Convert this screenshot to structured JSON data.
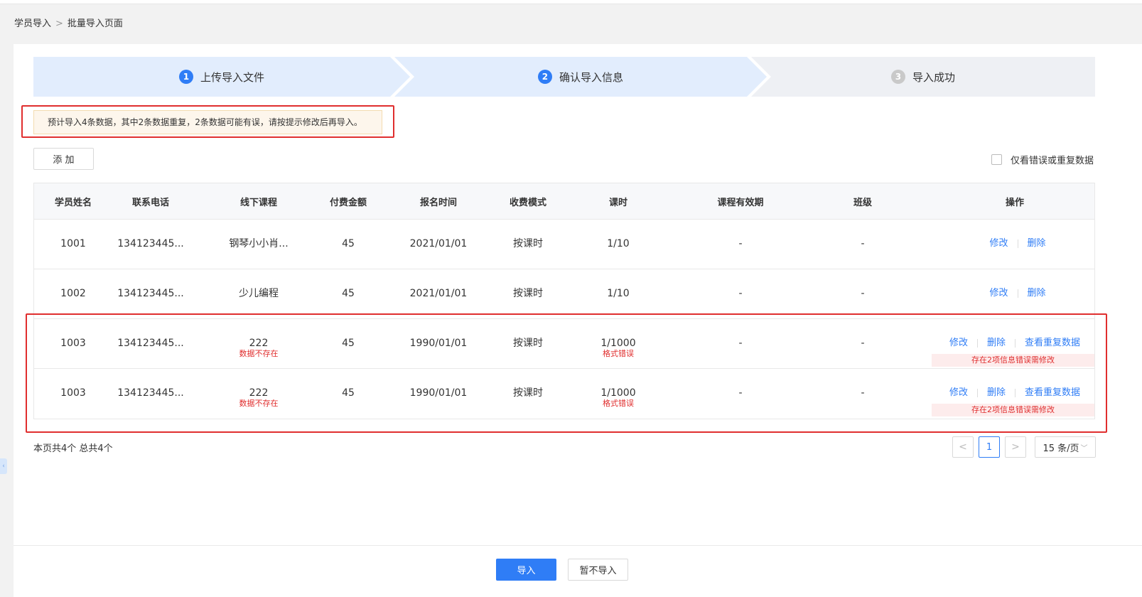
{
  "breadcrumb": {
    "parent": "学员导入",
    "separator": ">",
    "current": "批量导入页面"
  },
  "steps": [
    {
      "num": "1",
      "label": "上传导入文件",
      "state": "done"
    },
    {
      "num": "2",
      "label": "确认导入信息",
      "state": "active"
    },
    {
      "num": "3",
      "label": "导入成功",
      "state": "pending"
    }
  ],
  "notice": "预计导入4条数据，其中2条数据重复，2条数据可能有误，请按提示修改后再导入。",
  "toolbar": {
    "add_label": "添 加",
    "filter_label": "仅看错误或重复数据"
  },
  "table": {
    "columns": [
      "学员姓名",
      "联系电话",
      "线下课程",
      "付费金额",
      "报名时间",
      "收费模式",
      "课时",
      "课程有效期",
      "班级",
      "操作"
    ],
    "rows": [
      {
        "name": "1001",
        "phone": "134123445...",
        "course": "钢琴小小肖...",
        "course_err": "",
        "amount": "45",
        "date": "2021/01/01",
        "mode": "按课时",
        "hours": "1/10",
        "hours_err": "",
        "validity": "-",
        "class": "-",
        "op_edit": "修改",
        "op_delete": "删除",
        "op_dup": "",
        "op_warn": ""
      },
      {
        "name": "1002",
        "phone": "134123445...",
        "course": "少儿编程",
        "course_err": "",
        "amount": "45",
        "date": "2021/01/01",
        "mode": "按课时",
        "hours": "1/10",
        "hours_err": "",
        "validity": "-",
        "class": "-",
        "op_edit": "修改",
        "op_delete": "删除",
        "op_dup": "",
        "op_warn": ""
      },
      {
        "name": "1003",
        "phone": "134123445...",
        "course": "222",
        "course_err": "数据不存在",
        "amount": "45",
        "date": "1990/01/01",
        "mode": "按课时",
        "hours": "1/1000",
        "hours_err": "格式错误",
        "validity": "-",
        "class": "-",
        "op_edit": "修改",
        "op_delete": "删除",
        "op_dup": "查看重复数据",
        "op_warn": "存在2项信息错误需修改"
      },
      {
        "name": "1003",
        "phone": "134123445...",
        "course": "222",
        "course_err": "数据不存在",
        "amount": "45",
        "date": "1990/01/01",
        "mode": "按课时",
        "hours": "1/1000",
        "hours_err": "格式错误",
        "validity": "-",
        "class": "-",
        "op_edit": "修改",
        "op_delete": "删除",
        "op_dup": "查看重复数据",
        "op_warn": "存在2项信息错误需修改"
      }
    ]
  },
  "summary": "本页共4个 总共4个",
  "pagination": {
    "prev": "<",
    "current": "1",
    "next": ">",
    "page_size": "15 条/页"
  },
  "actions": {
    "import_label": "导入",
    "skip_label": "暂不导入"
  },
  "side_tab": "‹",
  "colors": {
    "primary": "#2f7df6",
    "error": "#e02e2e",
    "step_active_bg": "#e2edfd",
    "step_pending_bg": "#eef0f4"
  }
}
